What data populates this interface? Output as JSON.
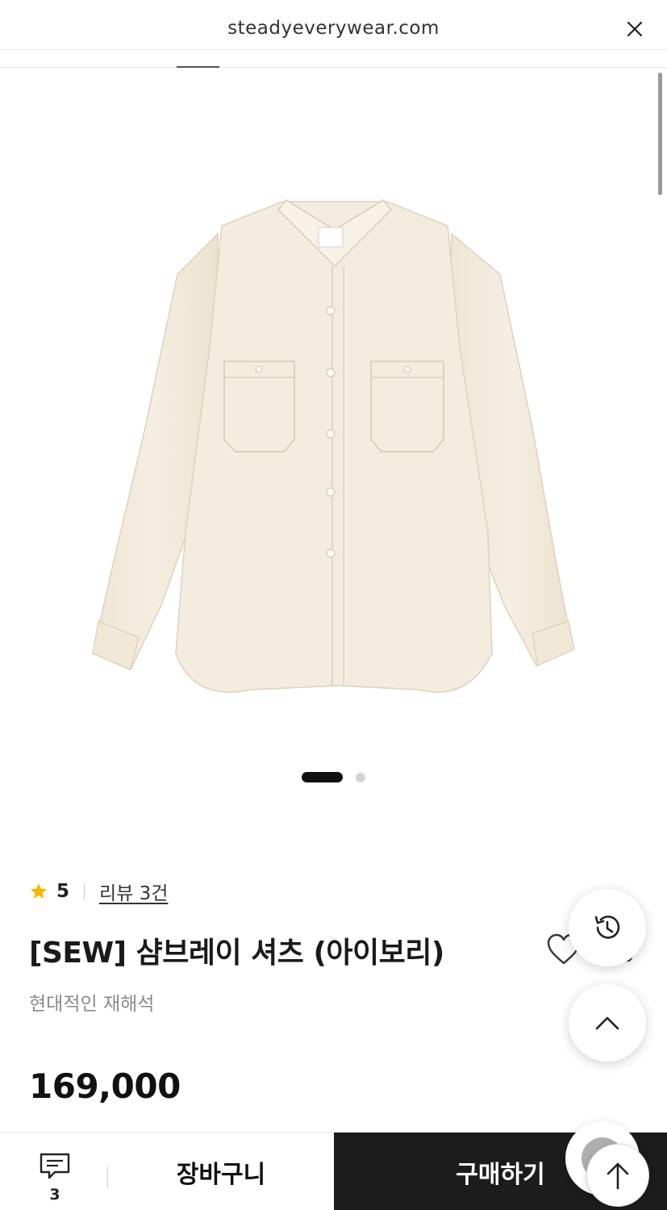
{
  "browser": {
    "domain": "steadyeverywear.com"
  },
  "gallery": {
    "total_slides": 2,
    "active_slide": 1
  },
  "product": {
    "rating": "5",
    "review_link": "리뷰 3건",
    "title": "[SEW] 샴브레이 셔츠 (아이보리)",
    "subtitle": "현대적인 재해석",
    "price": "169,000"
  },
  "bottom_bar": {
    "comment_count": "3",
    "cart_label": "장바구니",
    "buy_label": "구매하기"
  },
  "icons": {
    "close": "close-icon",
    "star": "star-icon",
    "heart": "heart-icon",
    "share": "share-icon",
    "history": "history-icon",
    "scroll_top": "chevron-up-icon",
    "comment": "comment-icon",
    "arrow_up": "arrow-up-icon"
  },
  "colors": {
    "star": "#F5B800",
    "buy_button": "#1C1C1C",
    "shirt": "#F3EBDD"
  }
}
